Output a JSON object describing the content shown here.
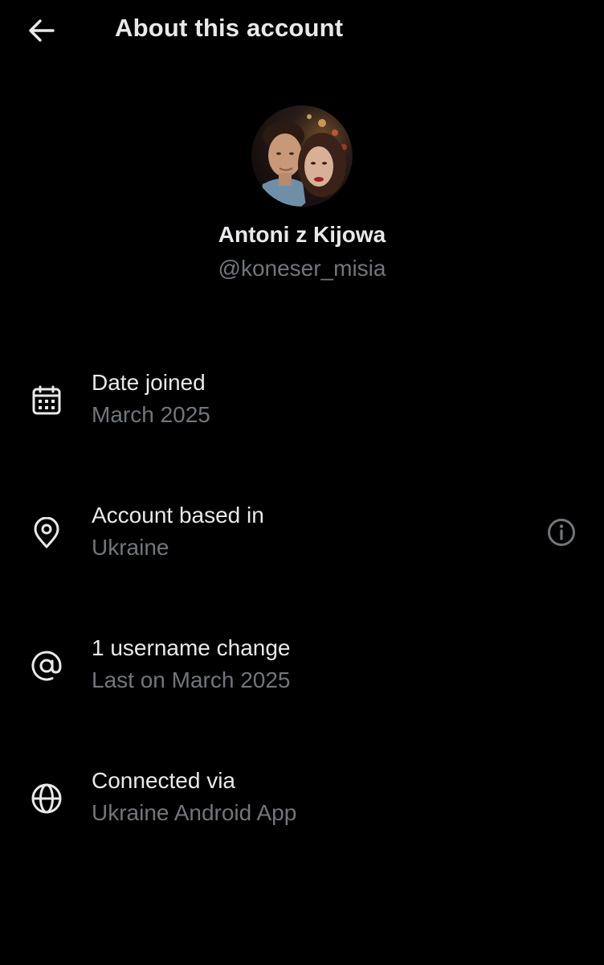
{
  "header": {
    "title": "About this account",
    "back_icon": "arrow-left-icon"
  },
  "profile": {
    "display_name": "Antoni z Kijowa",
    "handle": "@koneser_misia",
    "avatar": "avatar-photo"
  },
  "rows": [
    {
      "icon": "calendar-icon",
      "title": "Date joined",
      "subtitle": "March 2025"
    },
    {
      "icon": "location-pin-icon",
      "title": "Account based in",
      "subtitle": "Ukraine",
      "trailing_icon": "info-icon"
    },
    {
      "icon": "at-sign-icon",
      "title": "1 username change",
      "subtitle": "Last on March 2025"
    },
    {
      "icon": "globe-icon",
      "title": "Connected via",
      "subtitle": "Ukraine Android App"
    }
  ],
  "colors": {
    "background": "#000000",
    "primary_text": "#e7e9ea",
    "secondary_text": "#71767b"
  }
}
